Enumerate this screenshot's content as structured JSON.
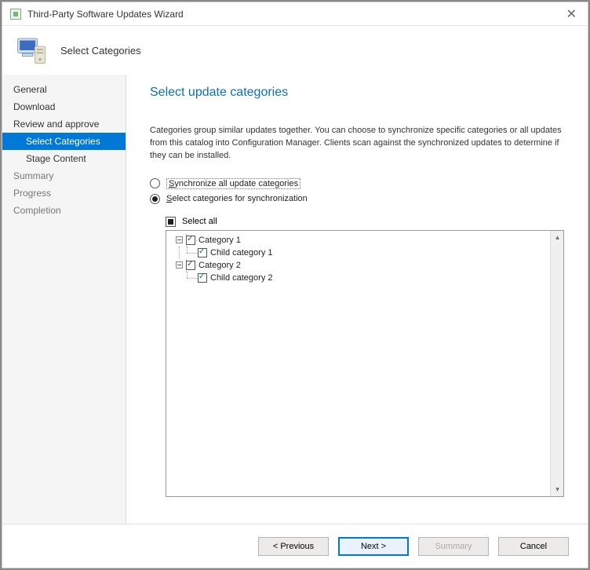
{
  "window": {
    "title": "Third-Party Software Updates Wizard"
  },
  "banner": {
    "title": "Select Categories"
  },
  "nav": {
    "items": [
      {
        "label": "General"
      },
      {
        "label": "Download"
      },
      {
        "label": "Review and approve"
      },
      {
        "label": "Select Categories"
      },
      {
        "label": "Stage Content"
      },
      {
        "label": "Summary"
      },
      {
        "label": "Progress"
      },
      {
        "label": "Completion"
      }
    ]
  },
  "page": {
    "title": "Select update categories",
    "description": "Categories group similar updates together. You can choose to synchronize specific categories or all updates from this catalog into Configuration Manager. Clients scan against the synchronized updates to determine if they can be installed.",
    "radio": {
      "sync_all": "Synchronize all update categories",
      "select_specific": "Select categories for synchronization"
    },
    "select_all": "Select all",
    "tree": [
      {
        "label": "Category 1",
        "child_label": "Child category 1"
      },
      {
        "label": "Category 2",
        "child_label": "Child category 2"
      }
    ]
  },
  "footer": {
    "previous": "< Previous",
    "next": "Next >",
    "summary": "Summary",
    "cancel": "Cancel"
  }
}
